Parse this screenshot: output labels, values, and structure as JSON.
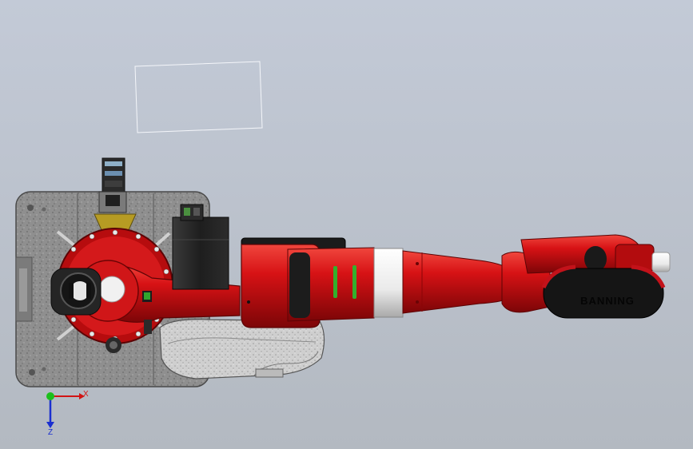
{
  "viewport": {
    "background_top": "#c2c9d6",
    "background_bottom": "#b4bac2",
    "model_colors": {
      "red": "#cc0d10",
      "red_dark": "#8a0608",
      "red_light": "#ea3a33",
      "black": "#1c1c1c",
      "steel": "#9a9a9a",
      "white_band": "#f2f2f2"
    }
  },
  "triad": {
    "x_label": "X",
    "z_label": "Z",
    "x_color": "#d21414",
    "y_color": "#1bbf1b",
    "z_color": "#1a2fd0"
  },
  "model": {
    "logo_text": "BANNING"
  }
}
